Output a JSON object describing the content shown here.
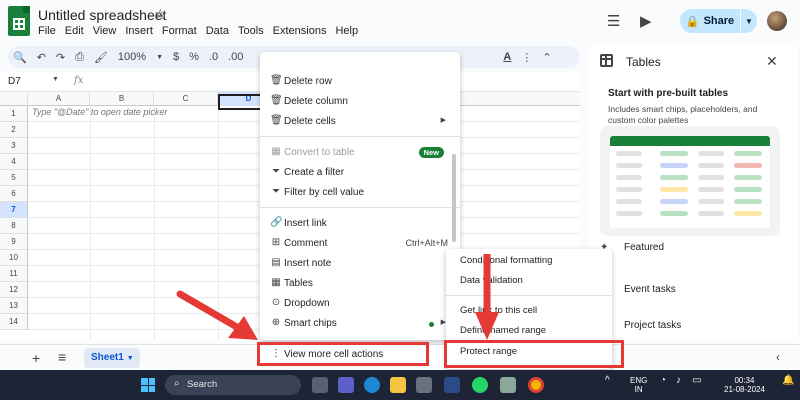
{
  "title_bar": {
    "doc_title": "Untitled spreadsheet",
    "menus": [
      "File",
      "Edit",
      "View",
      "Insert",
      "Format",
      "Data",
      "Tools",
      "Extensions",
      "Help"
    ],
    "share_label": "Share"
  },
  "toolbar": {
    "zoom": "100%",
    "currency": "$",
    "percent": "%",
    "decimal_dec": ".0",
    "decimal_inc": ".00"
  },
  "formula_bar": {
    "name_box": "D7",
    "fx": "fx"
  },
  "grid": {
    "columns": [
      "A",
      "B",
      "C",
      "D"
    ],
    "selected_column": "D",
    "rows": [
      "1",
      "2",
      "3",
      "4",
      "5",
      "6",
      "7",
      "8",
      "9",
      "10",
      "11",
      "12",
      "13",
      "14"
    ],
    "selected_row": "7",
    "a1_hint": "Type \"@Date\" to open date picker"
  },
  "context_menu": {
    "items": [
      {
        "label": "Delete row",
        "icon": "trash-icon"
      },
      {
        "label": "Delete column",
        "icon": "trash-icon"
      },
      {
        "label": "Delete cells",
        "icon": "trash-icon",
        "submenu": true
      },
      {
        "label": "Convert to table",
        "icon": "table-icon",
        "badge": "New",
        "disabled": true
      },
      {
        "label": "Create a filter",
        "icon": "filter-icon"
      },
      {
        "label": "Filter by cell value",
        "icon": "filter-icon"
      },
      {
        "label": "Insert link",
        "icon": "link-icon"
      },
      {
        "label": "Comment",
        "icon": "comment-icon",
        "shortcut": "Ctrl+Alt+M"
      },
      {
        "label": "Insert note",
        "icon": "note-icon"
      },
      {
        "label": "Tables",
        "icon": "tables-icon"
      },
      {
        "label": "Dropdown",
        "icon": "dropdown-icon"
      },
      {
        "label": "Smart chips",
        "icon": "chip-icon",
        "submenu": true
      },
      {
        "label": "View more cell actions",
        "icon": "more-vert-icon",
        "submenu": true
      }
    ]
  },
  "submenu": {
    "items": [
      "Conditional formatting",
      "Data validation",
      "Get link to this cell",
      "Define named range",
      "Protect range"
    ]
  },
  "side_panel": {
    "title": "Tables",
    "heading": "Start with pre-built tables",
    "description": "Includes smart chips, placeholders, and custom color palettes",
    "section": "Featured",
    "items": [
      "Event tasks",
      "Project tasks"
    ]
  },
  "sheet_bar": {
    "active_sheet": "Sheet1"
  },
  "taskbar": {
    "search_label": "Search",
    "lang": "ENG",
    "region": "IN",
    "time": "00:34",
    "date": "21-08-2024"
  },
  "colors": {
    "highlight": "#e53935",
    "accent_green": "#188038",
    "share_bg": "#c2e7ff"
  }
}
